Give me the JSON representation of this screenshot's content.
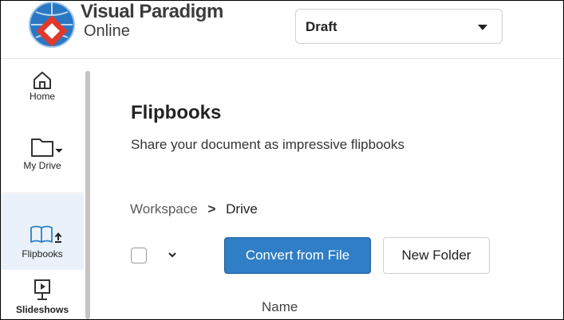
{
  "header": {
    "brand_line1": "Visual Paradigm",
    "brand_line2": "Online",
    "workspace_select": {
      "value": "Draft"
    }
  },
  "sidebar": {
    "items": [
      {
        "label": "Home",
        "icon": "home-icon"
      },
      {
        "label": "My Drive",
        "icon": "folder-icon"
      },
      {
        "label": "Flipbooks",
        "icon": "book-icon",
        "active": true
      },
      {
        "label": "Slideshows",
        "icon": "slideshow-icon"
      }
    ]
  },
  "main": {
    "title": "Flipbooks",
    "subtitle": "Share your document as impressive flipbooks",
    "breadcrumb": {
      "root": "Workspace",
      "separator": ">",
      "current": "Drive"
    },
    "toolbar": {
      "convert_label": "Convert from File",
      "new_folder_label": "New Folder",
      "select_dropdown": "⌄"
    },
    "table": {
      "columns": [
        "Name"
      ]
    }
  },
  "colors": {
    "primary_button": "#2f7ec6",
    "active_sidebar_bg": "#eaf1fa",
    "logo_red": "#e0392d",
    "logo_blue": "#1f6fb8"
  }
}
